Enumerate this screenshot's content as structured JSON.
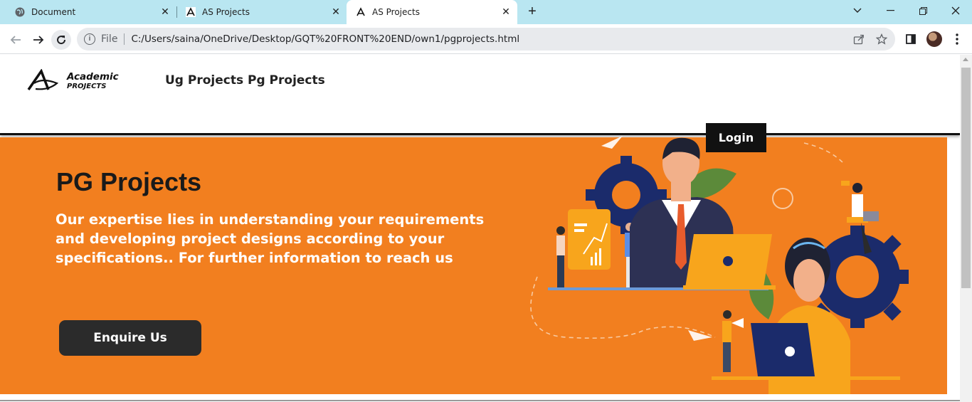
{
  "browser": {
    "tabs": [
      {
        "title": "Document",
        "icon": "globe-icon",
        "active": false
      },
      {
        "title": "AS Projects",
        "icon": "site-logo-icon",
        "active": false
      },
      {
        "title": "AS Projects",
        "icon": "site-logo-icon",
        "active": true
      }
    ],
    "address": {
      "scheme_label": "File",
      "url": "C:/Users/saina/OneDrive/Desktop/GQT%20FRONT%20END/own1/pgprojects.html"
    }
  },
  "site": {
    "logo": {
      "line1": "Academic",
      "line2": "PROJECTS",
      "mark": "A"
    },
    "nav": [
      {
        "label": "Ug Projects"
      },
      {
        "label": "Pg Projects"
      }
    ],
    "login_label": "Login"
  },
  "hero": {
    "title": "PG Projects",
    "text": "Our expertise lies in understanding your requirements and developing project designs according to your specifications.. For further information to reach us",
    "button_label": "Enquire Us",
    "background_color": "#f27f1f"
  }
}
